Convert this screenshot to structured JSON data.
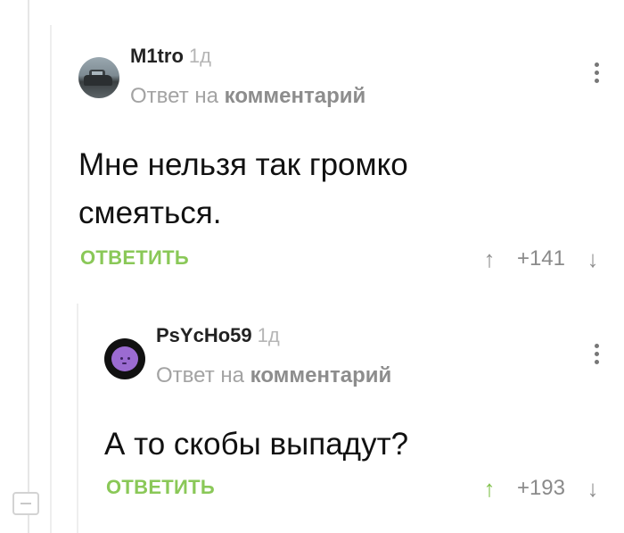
{
  "thread": {
    "collapse_label": "collapse"
  },
  "comments": [
    {
      "username": "M1tro",
      "time": "1д",
      "reply_prefix": "Ответ на",
      "reply_target": "комментарий",
      "text": "Мне нельзя так громко смеяться.",
      "reply_label": "ОТВЕТИТЬ",
      "up_icon": "↑",
      "rating": "+141",
      "down_icon": "↓",
      "avatar": "car-avatar",
      "upvoted": false
    },
    {
      "username": "PsYcHo59",
      "time": "1д",
      "reply_prefix": "Ответ на",
      "reply_target": "комментарий",
      "text": "А то скобы выпадут?",
      "reply_label": "ОТВЕТИТЬ",
      "up_icon": "↑",
      "rating": "+193",
      "down_icon": "↓",
      "avatar": "purple-blob-avatar",
      "upvoted": true
    }
  ],
  "colors": {
    "accent_green": "#8ac858",
    "upvote_active": "#7dbf47",
    "meta_gray": "#a3a3a3"
  }
}
